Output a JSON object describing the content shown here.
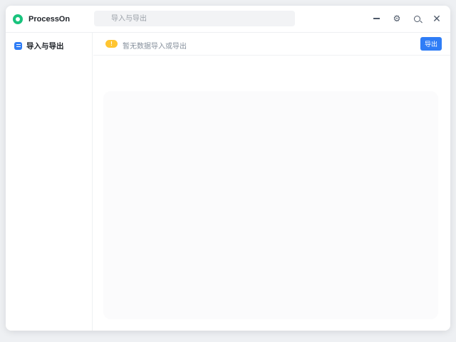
{
  "app": {
    "name": "ProcessOn",
    "brand_color": "#19c37d",
    "icon": "processon-logo-icon"
  },
  "search": {
    "placeholder": "导入与导出"
  },
  "window_controls": {
    "minimize": "—",
    "settings": "⚙",
    "search": "search-icon",
    "close": "✕"
  },
  "sidebar": {
    "items": [
      {
        "label": "导入与导出",
        "icon": "list-icon",
        "active": true
      }
    ]
  },
  "notice": {
    "badge": "!",
    "text": "暂无数据导入或导出",
    "badge_color": "#ffc531"
  },
  "action": {
    "label": "导出",
    "color": "#2f7df6"
  }
}
